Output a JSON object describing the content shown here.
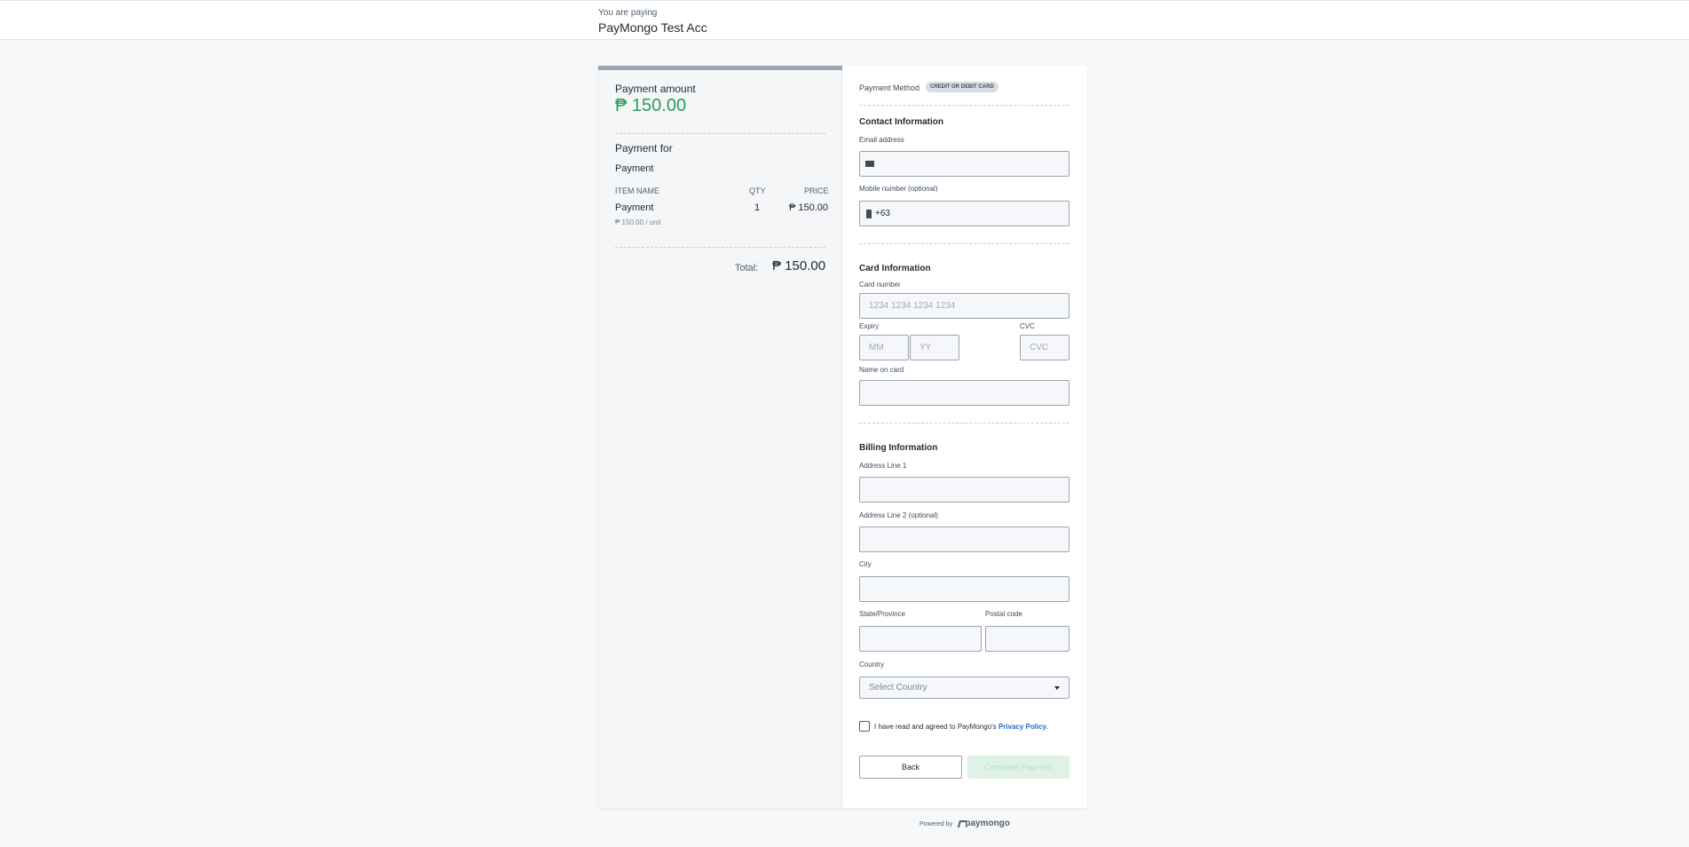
{
  "header": {
    "you_are_paying": "You are paying",
    "merchant": "PayMongo Test Acc"
  },
  "summary": {
    "amount_label": "Payment amount",
    "amount": "₱ 150.00",
    "payment_for_label": "Payment for",
    "payment_description": "Payment",
    "columns": [
      "ITEM NAME",
      "QTY",
      "PRICE"
    ],
    "items": [
      {
        "name": "Payment",
        "qty": "1",
        "price": "₱ 150.00",
        "unit_price": "₱ 150.00 / unit"
      }
    ],
    "total_label": "Total:",
    "total": "₱ 150.00"
  },
  "payment_method": {
    "label": "Payment Method",
    "badge": "CREDIT OR DEBIT CARD"
  },
  "contact": {
    "title": "Contact Information",
    "email_label": "Email address",
    "email_value": "",
    "mobile_label": "Mobile number (optional)",
    "mobile_value": "+63"
  },
  "card": {
    "title": "Card Information",
    "number_label": "Card number",
    "number_placeholder": "1234 1234 1234 1234",
    "expiry_label": "Expiry",
    "month_placeholder": "MM",
    "year_placeholder": "YY",
    "cvc_label": "CVC",
    "cvc_placeholder": "CVC",
    "name_label": "Name on card"
  },
  "billing": {
    "title": "Billing Information",
    "address1_label": "Address Line 1",
    "address2_label": "Address Line 2 (optional)",
    "city_label": "City",
    "state_label": "State/Province",
    "postal_label": "Postal code",
    "country_label": "Country",
    "country_placeholder": "Select Country"
  },
  "consent": {
    "text": "I have read and agreed to PayMongo's ",
    "link": "Privacy Policy",
    "suffix": "."
  },
  "actions": {
    "back": "Back",
    "complete": "Complete Payment"
  },
  "footer": {
    "powered_by": "Powered by",
    "brand": "paymongo"
  }
}
